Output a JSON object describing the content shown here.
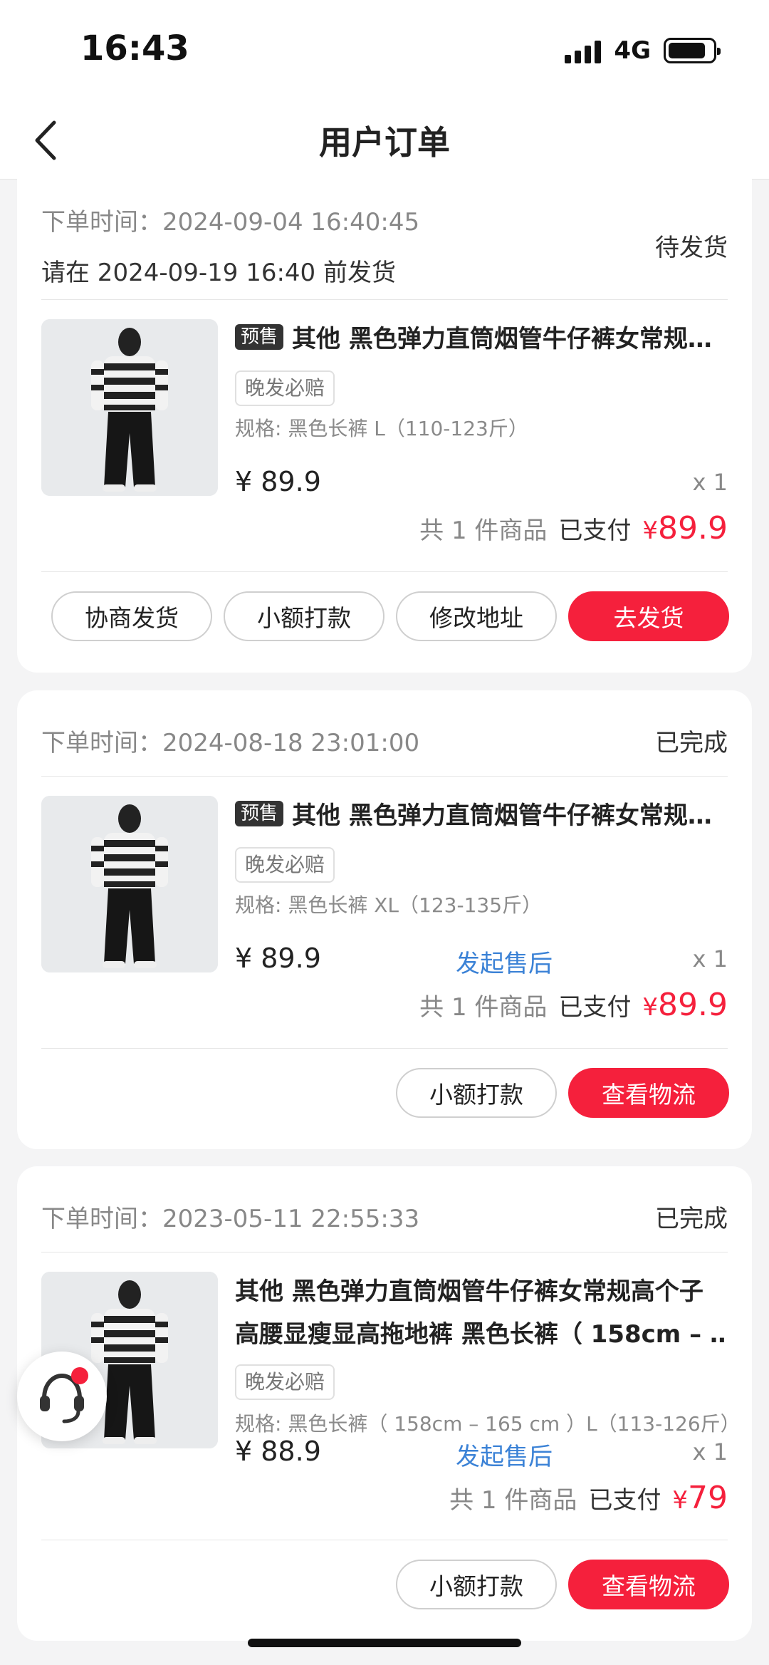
{
  "status_bar": {
    "time": "16:43",
    "network": "4G"
  },
  "nav": {
    "title": "用户订单"
  },
  "orders": [
    {
      "order_time_label": "下单时间：",
      "order_time": "2024-09-04 16:40:45",
      "deadline": "请在 2024-09-19 16:40 前发货",
      "status": "待发货",
      "presale_badge": "预售",
      "product_title": "其他 黑色弹力直筒烟管牛仔裤女常规高个子高腰显瘦显高拖地裤",
      "tag": "晚发必赔",
      "spec": "规格: 黑色长裤 L（110-123斤）",
      "price": "¥ 89.9",
      "qty": "x 1",
      "count_text": "共 1 件商品",
      "paid_label": "已支付",
      "currency": "¥",
      "paid_amount": "89.9",
      "buttons": [
        "协商发货",
        "小额打款",
        "修改地址",
        "去发货"
      ]
    },
    {
      "order_time_label": "下单时间：",
      "order_time": "2024-08-18 23:01:00",
      "status": "已完成",
      "presale_badge": "预售",
      "product_title": "其他 黑色弹力直筒烟管牛仔裤女常规高个子高腰显瘦显高拖地裤",
      "tag": "晚发必赔",
      "spec": "规格: 黑色长裤 XL（123-135斤）",
      "price": "¥ 89.9",
      "aftersale": "发起售后",
      "qty": "x 1",
      "count_text": "共 1 件商品",
      "paid_label": "已支付",
      "currency": "¥",
      "paid_amount": "89.9",
      "buttons": [
        "小额打款",
        "查看物流"
      ]
    },
    {
      "order_time_label": "下单时间：",
      "order_time": "2023-05-11 22:55:33",
      "status": "已完成",
      "product_title_line1": "其他 黑色弹力直筒烟管牛仔裤女常规高个子",
      "product_title_line2": "高腰显瘦显高拖地裤 黑色长裤（ 158cm – …",
      "tag": "晚发必赔",
      "spec": "规格: 黑色长裤（ 158cm – 165 cm ）L（113-126斤）",
      "price": "¥ 88.9",
      "aftersale": "发起售后",
      "qty": "x 1",
      "count_text": "共 1 件商品",
      "paid_label": "已支付",
      "currency": "¥",
      "paid_amount": "79",
      "buttons": [
        "小额打款",
        "查看物流"
      ]
    }
  ]
}
